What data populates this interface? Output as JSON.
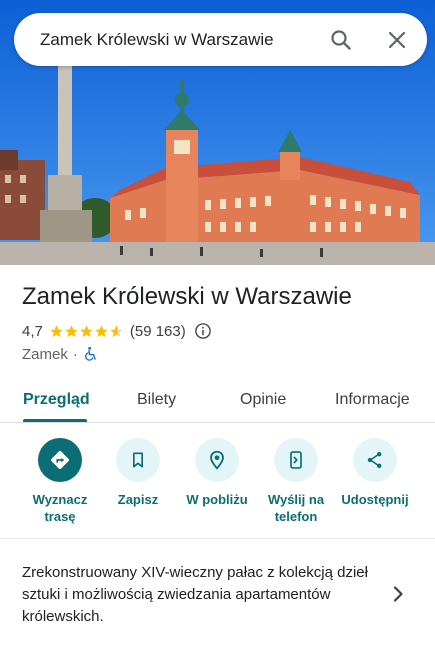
{
  "search": {
    "query": "Zamek Królewski w Warszawie"
  },
  "place": {
    "title": "Zamek Królewski w Warszawie",
    "rating": "4,7",
    "rating_stars": 4.7,
    "review_count": "(59 163)",
    "category": "Zamek",
    "separator": "·"
  },
  "tabs": [
    {
      "label": "Przegląd",
      "active": true
    },
    {
      "label": "Bilety",
      "active": false
    },
    {
      "label": "Opinie",
      "active": false
    },
    {
      "label": "Informacje",
      "active": false
    }
  ],
  "actions": [
    {
      "line1": "Wyznacz",
      "line2": "trasę",
      "icon": "directions-icon"
    },
    {
      "line1": "Zapisz",
      "line2": "",
      "icon": "bookmark-icon"
    },
    {
      "line1": "W pobliżu",
      "line2": "",
      "icon": "nearby-icon"
    },
    {
      "line1": "Wyślij na",
      "line2": "telefon",
      "icon": "send-to-phone-icon"
    },
    {
      "line1": "Udostępnij",
      "line2": "",
      "icon": "share-icon"
    }
  ],
  "description": "Zrekonstruowany XIV-wieczny pałac z kolekcją dzieł sztuki i możliwością zwiedzania apartamentów królewskich.",
  "colors": {
    "accent": "#0b6e74",
    "accent_light": "#e3f5f6",
    "star": "#fbbc04",
    "sky": "#1a73d9",
    "castle": "#e07a52"
  }
}
